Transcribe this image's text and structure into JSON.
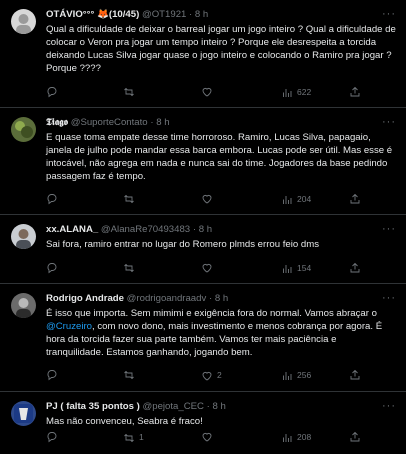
{
  "tweets": [
    {
      "name": "OTÁVIO°°° 🦊(10/45)",
      "handle": "@OT1921",
      "sep": "·",
      "time": "8 h",
      "text": "Qual a dificuldade de deixar o barreal jogar um jogo inteiro ? Qual a dificuldade de colocar o Veron pra jogar um tempo inteiro ? Porque ele desrespeita a torcida deixando Lucas Silva jogar quase o jogo inteiro e colocando o Ramiro pra jogar ? Porque ????",
      "replies": "",
      "retweets": "",
      "likes": "",
      "views": "622",
      "avatar_color": "#d8d8d8"
    },
    {
      "name": "𝕿𝖎𝖆𝖌𝖔",
      "handle": "@SuporteContato",
      "sep": "·",
      "time": "8 h",
      "text": "E quase toma empate desse time horroroso. Ramiro, Lucas Silva, papagaio, janela de julho pode mandar essa barca embora. Lucas pode ser útil. Mas esse é intocável, não agrega em nada e nunca sai do time. Jogadores da base pedindo passagem faz é tempo.",
      "replies": "",
      "retweets": "",
      "likes": "",
      "views": "204",
      "avatar_color": "#5b6d3a"
    },
    {
      "name": "xx.ALANA_",
      "handle": "@AlanaRe70493483",
      "sep": "·",
      "time": "8 h",
      "text": "Sai fora, ramiro entrar no lugar do Romero plmds errou feio dms",
      "replies": "",
      "retweets": "",
      "likes": "",
      "views": "154",
      "avatar_color": "#c9cdd2"
    },
    {
      "name": "Rodrigo Andrade",
      "handle": "@rodrigoandraadv",
      "sep": "·",
      "time": "8 h",
      "text_before": "É isso que importa. Sem mimimi e exigência fora do normal. Vamos abraçar o ",
      "mention": "@Cruzeiro",
      "text_after": ", com novo dono, mais investimento e menos cobrança por agora. É hora da torcida fazer sua parte também. Vamos ter mais paciência e tranquilidade. Estamos ganhando, jogando bem.",
      "replies": "",
      "retweets": "",
      "likes": "2",
      "views": "256",
      "avatar_color": "#6b6b6b"
    },
    {
      "name": "PJ ( falta 35 pontos )",
      "handle": "@pejota_CEC",
      "sep": "·",
      "time": "8 h",
      "text": "Mas não convenceu, Seabra é fraco!",
      "replies": "",
      "retweets": "1",
      "likes": "",
      "views": "208",
      "avatar_color": "#2e4a8c"
    }
  ],
  "more_label": "···",
  "colors": {
    "background": "#000000",
    "text": "#e7e9ea",
    "muted": "#71767b",
    "link": "#1d9bf0"
  }
}
